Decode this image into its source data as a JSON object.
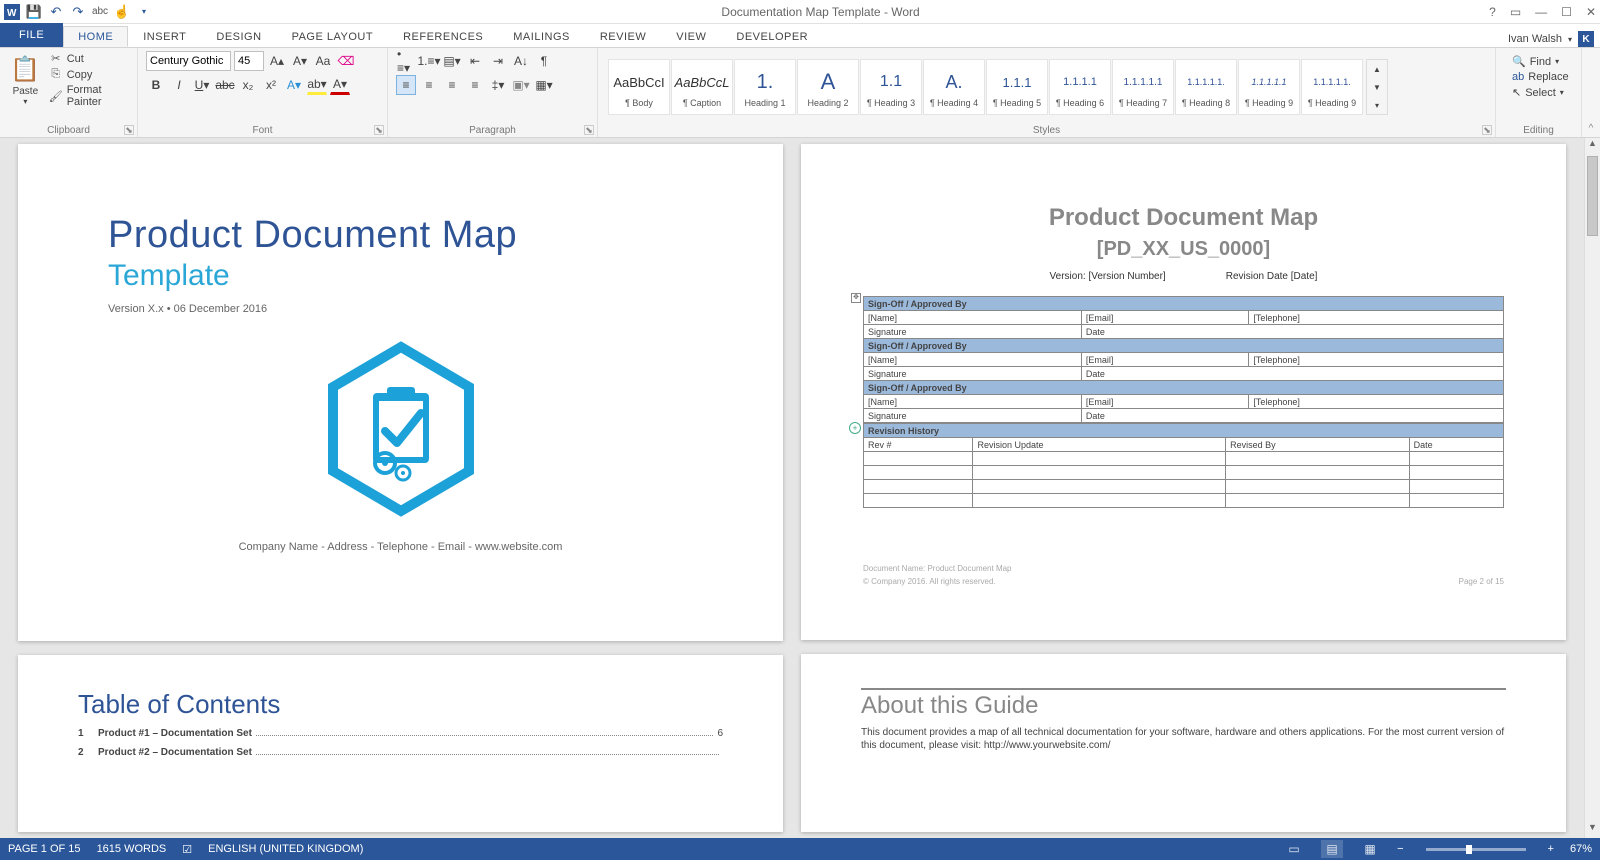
{
  "title": "Documentation Map Template - Word",
  "user": {
    "name": "Ivan Walsh",
    "initial": "K"
  },
  "qat": [
    "word-icon",
    "save",
    "undo",
    "redo",
    "spellcheck",
    "touch"
  ],
  "tabs": [
    "FILE",
    "HOME",
    "INSERT",
    "DESIGN",
    "PAGE LAYOUT",
    "REFERENCES",
    "MAILINGS",
    "REVIEW",
    "VIEW",
    "DEVELOPER"
  ],
  "activeTab": "HOME",
  "clipboard": {
    "paste": "Paste",
    "cut": "Cut",
    "copy": "Copy",
    "fmtpainter": "Format Painter",
    "label": "Clipboard"
  },
  "font": {
    "name": "Century Gothic",
    "size": "45",
    "label": "Font"
  },
  "paragraph": {
    "label": "Paragraph"
  },
  "stylesLabel": "Styles",
  "styles": [
    {
      "prev": "AaBbCcI",
      "name": "¶ Body"
    },
    {
      "prev": "AaBbCcL",
      "name": "¶ Caption"
    },
    {
      "prev": "1.",
      "name": "Heading 1"
    },
    {
      "prev": "A",
      "name": "Heading 2"
    },
    {
      "prev": "1.1",
      "name": "¶ Heading 3"
    },
    {
      "prev": "A.",
      "name": "¶ Heading 4"
    },
    {
      "prev": "1.1.1",
      "name": "¶ Heading 5"
    },
    {
      "prev": "1.1.1.1",
      "name": "¶ Heading 6"
    },
    {
      "prev": "1.1.1.1.1",
      "name": "¶ Heading 7"
    },
    {
      "prev": "1.1.1.1.1.",
      "name": "¶ Heading 8"
    },
    {
      "prev": "1.1.1.1.1",
      "name": "¶ Heading 9"
    },
    {
      "prev": "1.1.1.1.1.",
      "name": "¶ Heading 9"
    }
  ],
  "editing": {
    "find": "Find",
    "replace": "Replace",
    "select": "Select",
    "label": "Editing"
  },
  "page1": {
    "title": "Product Document Map",
    "sub": "Template",
    "version": "Version X.x • 06 December 2016",
    "footer": "Company Name - Address - Telephone - Email - www.website.com"
  },
  "page2": {
    "title": "Product Document Map",
    "code": "[PD_XX_US_0000]",
    "ver": "Version: [Version Number]",
    "rev": "Revision Date [Date]",
    "signHdr": "Sign-Off / Approved By",
    "name": "[Name]",
    "email": "[Email]",
    "tel": "[Telephone]",
    "sig": "Signature",
    "date": "Date",
    "revHist": "Revision History",
    "revCols": [
      "Rev #",
      "Revision Update",
      "Revised By",
      "Date"
    ],
    "foot1": "Document Name: Product Document Map",
    "foot2a": "© Company 2016. All rights reserved.",
    "foot2b": "Page 2 of 15"
  },
  "page3": {
    "title": "Table of Contents",
    "items": [
      {
        "n": "1",
        "t": "Product #1 – Documentation Set",
        "p": "6"
      },
      {
        "n": "2",
        "t": "Product #2 – Documentation Set",
        "p": ""
      }
    ]
  },
  "page4": {
    "title": "About this Guide",
    "p": "This document provides a map of all technical documentation for your software, hardware and others applications. For the most current version of this document, please visit: http://www.yourwebsite.com/"
  },
  "status": {
    "page": "PAGE 1 OF 15",
    "words": "1615 WORDS",
    "lang": "ENGLISH (UNITED KINGDOM)",
    "zoom": "67%"
  }
}
